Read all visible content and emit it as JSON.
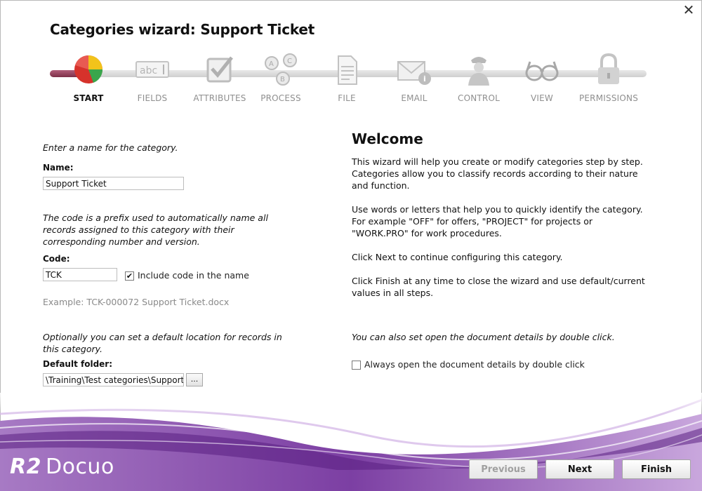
{
  "window": {
    "title": "Categories wizard:  Support Ticket",
    "close_glyph": "✕"
  },
  "steps": [
    {
      "label": "START",
      "icon": "pie-chart-icon",
      "active": true
    },
    {
      "label": "FIELDS",
      "icon": "text-field-icon"
    },
    {
      "label": "ATTRIBUTES",
      "icon": "checkbox-icon"
    },
    {
      "label": "PROCESS",
      "icon": "process-icon"
    },
    {
      "label": "FILE",
      "icon": "document-icon"
    },
    {
      "label": "EMAIL",
      "icon": "email-icon"
    },
    {
      "label": "CONTROL",
      "icon": "security-guard-icon"
    },
    {
      "label": "VIEW",
      "icon": "glasses-icon"
    },
    {
      "label": "PERMISSIONS",
      "icon": "padlock-icon"
    }
  ],
  "form": {
    "name_intro": "Enter a name for the category.",
    "name_label": "Name:",
    "name_value": "Support Ticket",
    "code_intro": "The code is a prefix used to automatically name all records assigned to this category with their corresponding number and version.",
    "code_label": "Code:",
    "code_value": "TCK",
    "include_code_label": "Include code in the name",
    "include_code_checked": true,
    "example": "Example: TCK-000072 Support Ticket.docx",
    "folder_intro": "Optionally you can set a default location for records in this category.",
    "folder_label": "Default folder:",
    "folder_value": "\\Training\\Test categories\\Support Tic",
    "browse_label": "..."
  },
  "welcome": {
    "title": "Welcome",
    "p1": "This wizard will help you create or modify categories step by step. Categories allow you to classify records according to their nature and function.",
    "p2": "Use words or letters that help you to quickly identify the category. For example \"OFF\" for offers, \"PROJECT\" for projects or \"WORK.PRO\" for work procedures.",
    "p3": "Click Next to continue configuring this category.",
    "p4": "Click Finish at any time to close the wizard and use default/current values in all steps.",
    "double_click_note": "You can also set open the document details by double click.",
    "double_click_checkbox_label": "Always open the document details by double click",
    "double_click_checked": false
  },
  "footer": {
    "logo_r2": "R2",
    "logo_docuo": "Docuo",
    "previous_label": "Previous",
    "next_label": "Next",
    "finish_label": "Finish"
  },
  "colors": {
    "accent_purple": "#8e4fb0",
    "pie_red": "#d6322b",
    "pie_yellow": "#f2c31b",
    "pie_green": "#3aa64c"
  }
}
